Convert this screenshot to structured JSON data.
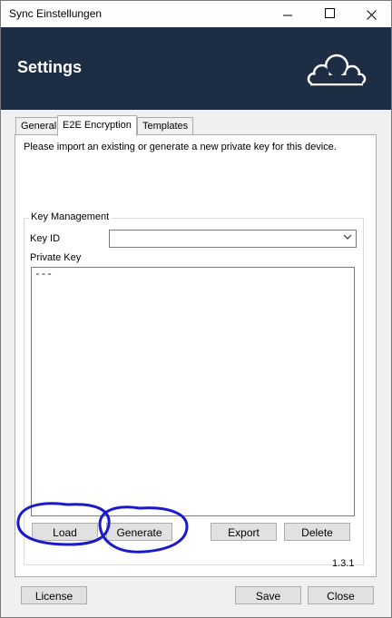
{
  "window": {
    "title": "Sync Einstellungen",
    "controls": [
      "minimize-icon",
      "maximize-icon",
      "close-icon"
    ]
  },
  "header": {
    "title": "Settings",
    "bg_color": "#1d2d44",
    "logo_icon": "cloud-icon"
  },
  "tabs": [
    {
      "label": "General",
      "selected": false
    },
    {
      "label": "E2E Encryption",
      "selected": true
    },
    {
      "label": "Templates",
      "selected": false
    }
  ],
  "encryption": {
    "intro": "Please import an existing or generate a new private key for this device.",
    "group_label": "Key Management",
    "key_id_label": "Key ID",
    "key_id_value": "",
    "private_key_label": "Private Key",
    "private_key_value": "---",
    "buttons": {
      "load": "Load",
      "generate": "Generate",
      "export": "Export",
      "delete": "Delete"
    },
    "version": "1.3.1"
  },
  "footer": {
    "license": "License",
    "save": "Save",
    "close": "Close"
  },
  "annotation": {
    "color": "#1a1acc"
  }
}
